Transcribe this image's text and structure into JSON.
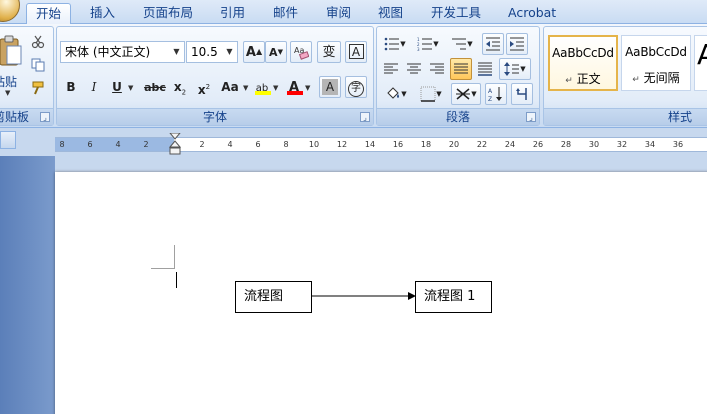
{
  "tabs": [
    {
      "label": "开始",
      "active": true
    },
    {
      "label": "插入"
    },
    {
      "label": "页面布局"
    },
    {
      "label": "引用"
    },
    {
      "label": "邮件"
    },
    {
      "label": "审阅"
    },
    {
      "label": "视图"
    },
    {
      "label": "开发工具"
    },
    {
      "label": "Acrobat"
    }
  ],
  "clipboard": {
    "paste_label": "粘贴",
    "group_label": "剪贴板"
  },
  "font": {
    "font_name": "宋体 (中文正文)",
    "font_size": "10.5",
    "grow_glyph": "A",
    "shrink_glyph": "A",
    "phonetic_glyph": "变",
    "border_glyph": "A",
    "bold": "B",
    "italic": "I",
    "underline": "U",
    "strike": "abc",
    "subscript": "x",
    "superscript": "x",
    "case": "Aa",
    "highlight": "ab",
    "font_color": "A",
    "char_shading": "A",
    "enclose": "字",
    "group_label": "字体"
  },
  "paragraph": {
    "group_label": "段落"
  },
  "styles": {
    "items": [
      {
        "sample": "AaBbCcDd",
        "name": "正文",
        "selected": true
      },
      {
        "sample": "AaBbCcDd",
        "name": "无间隔"
      },
      {
        "sample": "A",
        "name": ""
      }
    ],
    "group_label": "样式"
  },
  "ruler": {
    "left_numbers": [
      "8",
      "6",
      "4",
      "2"
    ],
    "right_numbers": [
      "2",
      "4",
      "6",
      "8",
      "10",
      "12",
      "14",
      "16",
      "18",
      "20",
      "22",
      "24",
      "26",
      "28",
      "30",
      "32",
      "34",
      "36"
    ]
  },
  "document": {
    "flowchart": [
      {
        "text": "流程图"
      },
      {
        "text": "流程图 1"
      }
    ]
  },
  "colors": {
    "highlight": "#ffff00",
    "font_color": "#ff0000",
    "accent": "#15428b"
  }
}
